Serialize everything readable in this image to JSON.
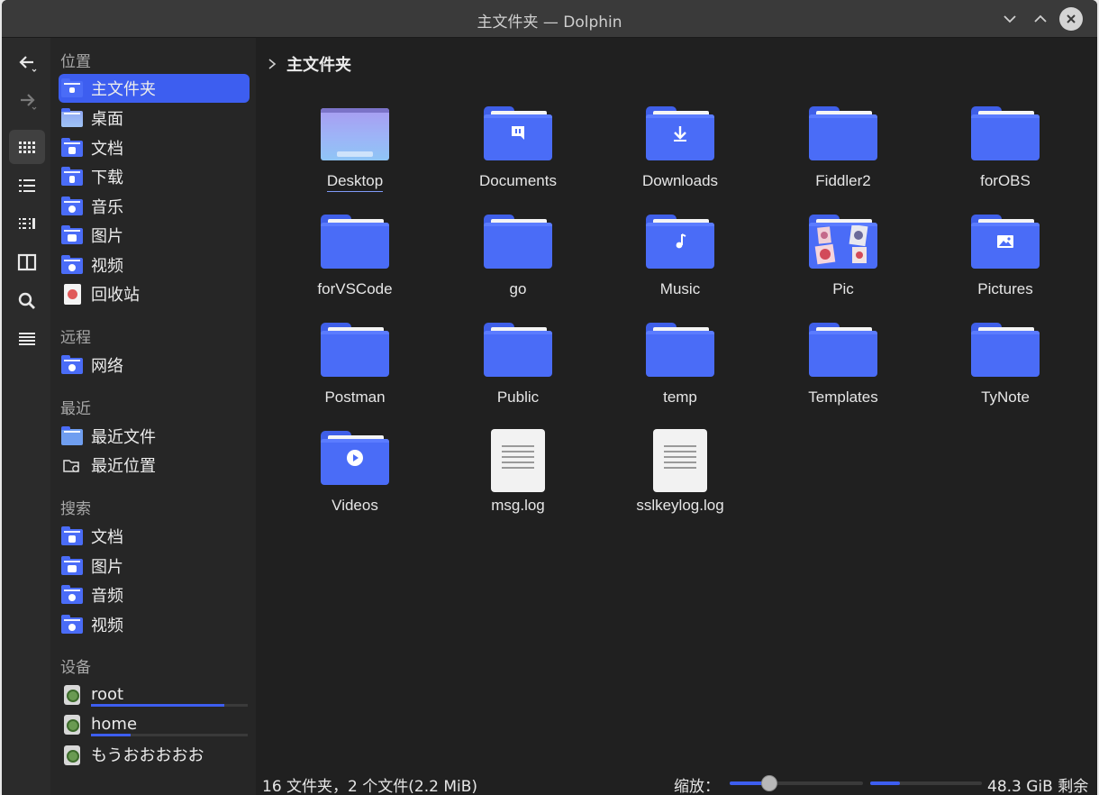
{
  "window": {
    "title": "主文件夹 — Dolphin"
  },
  "toolbar": {
    "tools": [
      "back-icon",
      "forward-icon",
      "icons-view-icon",
      "details-view-icon",
      "compact-view-icon",
      "split-view-icon",
      "search-icon",
      "menu-icon"
    ],
    "active": "icons-view-icon"
  },
  "places": {
    "headings": {
      "places": "位置",
      "remote": "远程",
      "recent": "最近",
      "search": "搜索",
      "devices": "设备"
    },
    "places_items": [
      "主文件夹",
      "桌面",
      "文档",
      "下载",
      "音乐",
      "图片",
      "视频",
      "回收站"
    ],
    "remote_items": [
      "网络"
    ],
    "recent_items": [
      "最近文件",
      "最近位置"
    ],
    "search_items": [
      "文档",
      "图片",
      "音频",
      "视频"
    ],
    "devices": [
      {
        "label": "root",
        "used_fraction": 0.85
      },
      {
        "label": "home",
        "used_fraction": 0.25
      },
      {
        "label": "もうおおおおお",
        "used_fraction": null
      }
    ],
    "selected": "主文件夹"
  },
  "breadcrumb": {
    "current": "主文件夹"
  },
  "files": [
    {
      "name": "Desktop",
      "type": "desktop"
    },
    {
      "name": "Documents",
      "type": "folder",
      "emblem": "document"
    },
    {
      "name": "Downloads",
      "type": "folder",
      "emblem": "download"
    },
    {
      "name": "Fiddler2",
      "type": "folder"
    },
    {
      "name": "forOBS",
      "type": "folder"
    },
    {
      "name": "forVSCode",
      "type": "folder"
    },
    {
      "name": "go",
      "type": "folder"
    },
    {
      "name": "Music",
      "type": "folder",
      "emblem": "music"
    },
    {
      "name": "Pic",
      "type": "folder",
      "emblem": "thumbnails"
    },
    {
      "name": "Pictures",
      "type": "folder",
      "emblem": "picture"
    },
    {
      "name": "Postman",
      "type": "folder"
    },
    {
      "name": "Public",
      "type": "folder"
    },
    {
      "name": "temp",
      "type": "folder"
    },
    {
      "name": "Templates",
      "type": "folder"
    },
    {
      "name": "TyNote",
      "type": "folder"
    },
    {
      "name": "Videos",
      "type": "folder",
      "emblem": "video"
    },
    {
      "name": "msg.log",
      "type": "text"
    },
    {
      "name": "sslkeylog.log",
      "type": "text"
    }
  ],
  "status": {
    "summary": "16 文件夹，2 个文件(2.2 MiB)",
    "zoom_label": "缩放：",
    "zoom_fraction": 0.3,
    "disk_used_fraction": 0.27,
    "free_space": "48.3 GiB 剩余"
  },
  "colors": {
    "accent": "#3d5ef0",
    "folder": "#4a6cf7",
    "background": "#202020"
  }
}
